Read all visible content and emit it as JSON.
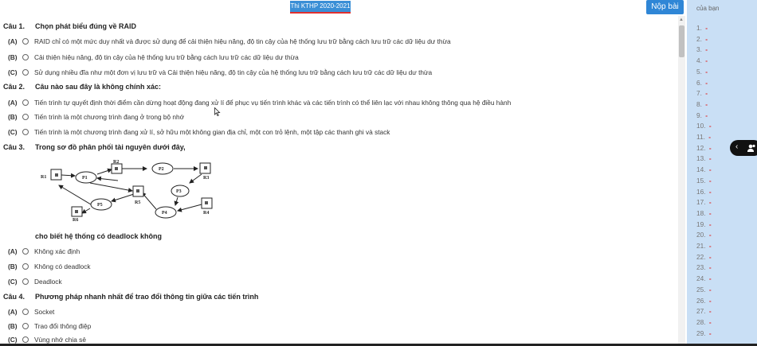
{
  "header": {
    "exam_badge": "Thi KTHP 2020-2021",
    "submit_label": "Nộp bài"
  },
  "side_panel": {
    "title": "của bạn",
    "items": [
      {
        "num": "1."
      },
      {
        "num": "2."
      },
      {
        "num": "3."
      },
      {
        "num": "4."
      },
      {
        "num": "5."
      },
      {
        "num": "6."
      },
      {
        "num": "7."
      },
      {
        "num": "8."
      },
      {
        "num": "9."
      },
      {
        "num": "10."
      },
      {
        "num": "11."
      },
      {
        "num": "12."
      },
      {
        "num": "13."
      },
      {
        "num": "14."
      },
      {
        "num": "15."
      },
      {
        "num": "16."
      },
      {
        "num": "17."
      },
      {
        "num": "18."
      },
      {
        "num": "19."
      },
      {
        "num": "20."
      },
      {
        "num": "21."
      },
      {
        "num": "22."
      },
      {
        "num": "23."
      },
      {
        "num": "24."
      },
      {
        "num": "25."
      },
      {
        "num": "26."
      },
      {
        "num": "27."
      },
      {
        "num": "28."
      },
      {
        "num": "29."
      }
    ],
    "dash": "-"
  },
  "questions": [
    {
      "num": "Câu 1.",
      "text": "Chọn phát biểu đúng về RAID",
      "options": [
        {
          "label": "(A)",
          "text": "RAID chỉ có một mức duy nhất và được sử dụng để cải thiện hiệu năng, độ tin cậy của hệ thống lưu trữ bằng cách lưu trữ các dữ liệu dư thừa"
        },
        {
          "label": "(B)",
          "text": "Cải thiện hiệu năng, độ tin cậy của hệ thống lưu trữ bằng cách lưu trữ các dữ liệu dư thừa"
        },
        {
          "label": "(C)",
          "text": "Sử dụng nhiều đĩa như một đơn vị lưu trữ và Cải thiện hiệu năng, độ tin cậy của hệ thống lưu trữ bằng cách lưu trữ các dữ liệu dư thừa"
        }
      ]
    },
    {
      "num": "Câu 2.",
      "text": "Câu nào sau đây là không chính xác:",
      "options": [
        {
          "label": "(A)",
          "text": "Tiến trình tự quyết định thời điểm cần dừng hoạt động đang xử lí để phục vụ tiến trình khác và các tiến trình có thể liên lạc với nhau không thông qua hệ điều hành"
        },
        {
          "label": "(B)",
          "text": "Tiến trình là một chương trình đang ở trong bộ nhớ"
        },
        {
          "label": "(C)",
          "text": "Tiến trình là một chương trình đang xử lí, sở hữu một không gian địa chỉ, một con trỏ lệnh, một tập các thanh ghi và stack"
        }
      ]
    },
    {
      "num": "Câu 3.",
      "text": "Trong sơ đồ phân phối tài nguyên dưới đây,",
      "followup": "cho biết hệ thống có deadlock không",
      "diagram_labels": [
        "R1",
        "P1",
        "R2",
        "P2",
        "R3",
        "P3",
        "R5",
        "P5",
        "R6",
        "P4",
        "R4"
      ],
      "options": [
        {
          "label": "(A)",
          "text": "Không xác định"
        },
        {
          "label": "(B)",
          "text": "Không có deadlock"
        },
        {
          "label": "(C)",
          "text": "Deadlock"
        }
      ]
    },
    {
      "num": "Câu 4.",
      "text": "Phương pháp nhanh nhất để trao đổi thông tin giữa các tiến trình",
      "options": [
        {
          "label": "(A)",
          "text": "Socket"
        },
        {
          "label": "(B)",
          "text": "Trao đổi thông điệp"
        },
        {
          "label": "(C)",
          "text": "Vùng nhớ chia sẻ"
        }
      ]
    }
  ]
}
